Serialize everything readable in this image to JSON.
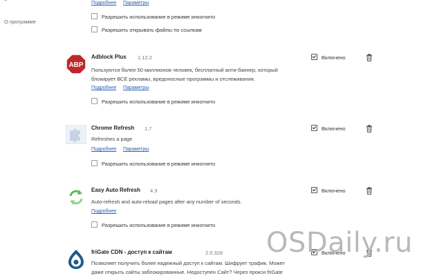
{
  "sidebar": {
    "items": [
      "о",
      "О программе"
    ]
  },
  "top_fragment": {
    "links": [
      "Подробнее",
      "Параметры"
    ],
    "options": [
      "Разрешить использование в режиме инкогнито",
      "Разрешить открывать файлы по ссылкам"
    ]
  },
  "extensions": [
    {
      "name": "Adblock Plus",
      "version": "1.12.2",
      "desc1": "Пользуются более 50 миллионов человек, бесплатный анти-баннер, который",
      "desc2": "блокирует ВСЕ рекламы, вредоносные программы и отслеживания.",
      "more": "Подробнее",
      "params": "Параметры",
      "incognito": "Разрешить использование в режиме инкогнито",
      "enabled": "Включено"
    },
    {
      "name": "Chrome Refresh",
      "version": "1.7",
      "desc1": "Refreshes a page",
      "more": "Подробнее",
      "params": "Параметры",
      "incognito": "Разрешить использование в режиме инкогнито",
      "enabled": "Включено"
    },
    {
      "name": "Easy Auto Refresh",
      "version": "4.3",
      "desc1": "Auto-refresh and auto-reload pages after any number of seconds.",
      "more": "Подробнее",
      "incognito": "Разрешить использование в режиме инкогнито",
      "enabled": "Включено"
    },
    {
      "name": "friGate CDN - доступ к сайтам",
      "version": "2.0.328",
      "desc1": "Позволяет получить более надежный доступ к сайтам. Шифрует трафик. Может",
      "desc2": "даже открыть сайты заблокированные. Недоступен Сайт? Через прокси friGate",
      "enabled": "Включено"
    }
  ],
  "icons": {
    "abp": "ABP",
    "colors": {
      "abp": "#c0272d",
      "link": "#2a5db0",
      "refresh": "#5cb85c",
      "frigate": "#1d5b8a"
    }
  },
  "watermark": "OSDaily.ru"
}
